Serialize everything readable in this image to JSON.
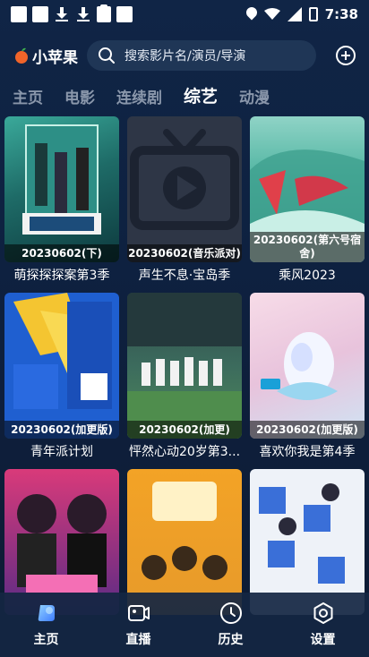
{
  "status_bar": {
    "time": "7:38"
  },
  "header": {
    "app_name": "小苹果",
    "search_placeholder": "搜索影片名/演员/导演",
    "logo_icon": "apple-icon",
    "add_icon": "plus-circle-icon"
  },
  "tabs": [
    {
      "label": "主页",
      "active": false
    },
    {
      "label": "电影",
      "active": false
    },
    {
      "label": "连续剧",
      "active": false
    },
    {
      "label": "综艺",
      "active": true
    },
    {
      "label": "动漫",
      "active": false
    }
  ],
  "items": [
    {
      "caption": "20230602(下)",
      "title": "萌探探探案第3季"
    },
    {
      "caption": "20230602(音乐派对)",
      "title": "声生不息·宝岛季"
    },
    {
      "caption": "20230602(第六号宿舍)",
      "title": "乘风2023"
    },
    {
      "caption": "20230602(加更版)",
      "title": "青年派计划"
    },
    {
      "caption": "20230602(加更)",
      "title": "怦然心动20岁第3..."
    },
    {
      "caption": "20230602(加更版)",
      "title": "喜欢你我是第4季"
    },
    {
      "caption": "",
      "title": ""
    },
    {
      "caption": "",
      "title": ""
    },
    {
      "caption": "",
      "title": ""
    }
  ],
  "bottom_nav": [
    {
      "label": "主页",
      "icon": "home-icon",
      "active": true
    },
    {
      "label": "直播",
      "icon": "live-camera-icon",
      "active": false
    },
    {
      "label": "历史",
      "icon": "clock-icon",
      "active": false
    },
    {
      "label": "设置",
      "icon": "settings-icon",
      "active": false
    }
  ],
  "colors": {
    "accent": "#5fa8ff",
    "background": "#0e2140"
  }
}
